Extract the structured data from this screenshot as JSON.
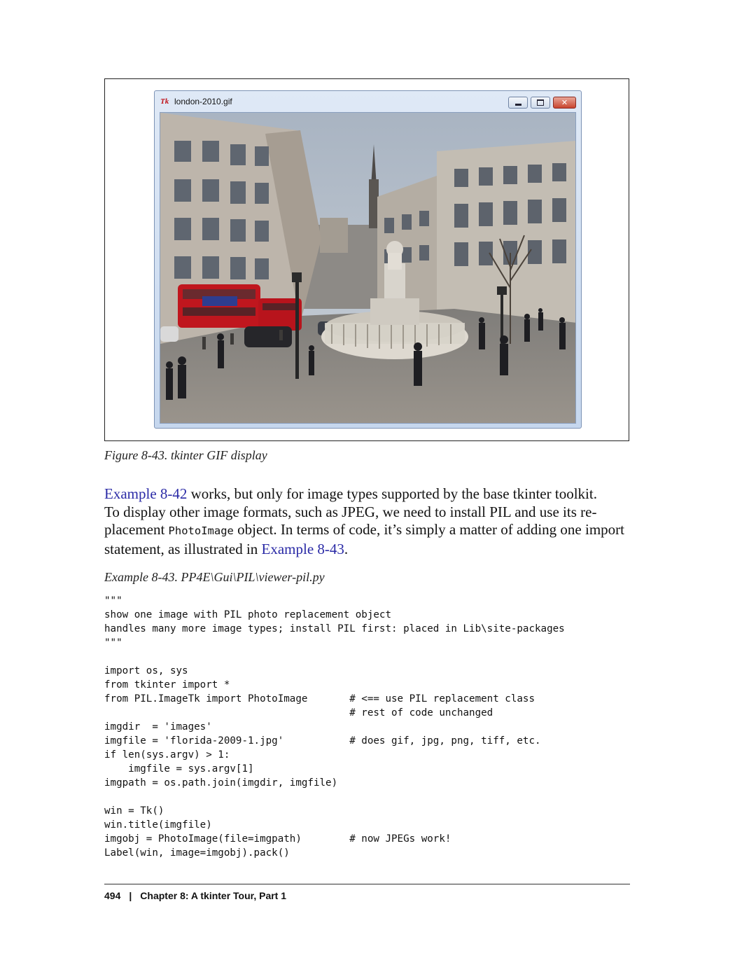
{
  "figure": {
    "window_title": "london-2010.gif",
    "tk_icon": "Tk",
    "controls": [
      "minimize-icon",
      "maximize-icon",
      "close-icon"
    ],
    "close_label": "✕",
    "caption": "Figure 8-43. tkinter GIF display"
  },
  "paragraph": {
    "link1": "Example 8-42",
    "line1_rest": " works, but only for image types supported by the base tkinter toolkit.",
    "line2": "To display other image formats, such as JPEG, we need to install PIL and use its re-",
    "line3_pre": "placement ",
    "line3_code": "PhotoImage",
    "line3_post": " object. In terms of code, it’s simply a matter of adding one import",
    "line4_pre": "statement, as illustrated in ",
    "link2": "Example 8-43",
    "line4_post": "."
  },
  "example_title": "Example 8-43. PP4E\\Gui\\PIL\\viewer-pil.py",
  "code": "\"\"\"\nshow one image with PIL photo replacement object\nhandles many more image types; install PIL first: placed in Lib\\site-packages\n\"\"\"\n\nimport os, sys\nfrom tkinter import *\nfrom PIL.ImageTk import PhotoImage       # <== use PIL replacement class\n                                         # rest of code unchanged\nimgdir  = 'images'\nimgfile = 'florida-2009-1.jpg'           # does gif, jpg, png, tiff, etc.\nif len(sys.argv) > 1:\n    imgfile = sys.argv[1]\nimgpath = os.path.join(imgdir, imgfile)\n\nwin = Tk()\nwin.title(imgfile)\nimgobj = PhotoImage(file=imgpath)        # now JPEGs work!\nLabel(win, image=imgobj).pack()",
  "footer": {
    "page_number": "494",
    "separator": "|",
    "chapter": "Chapter 8: A tkinter Tour, Part 1"
  }
}
